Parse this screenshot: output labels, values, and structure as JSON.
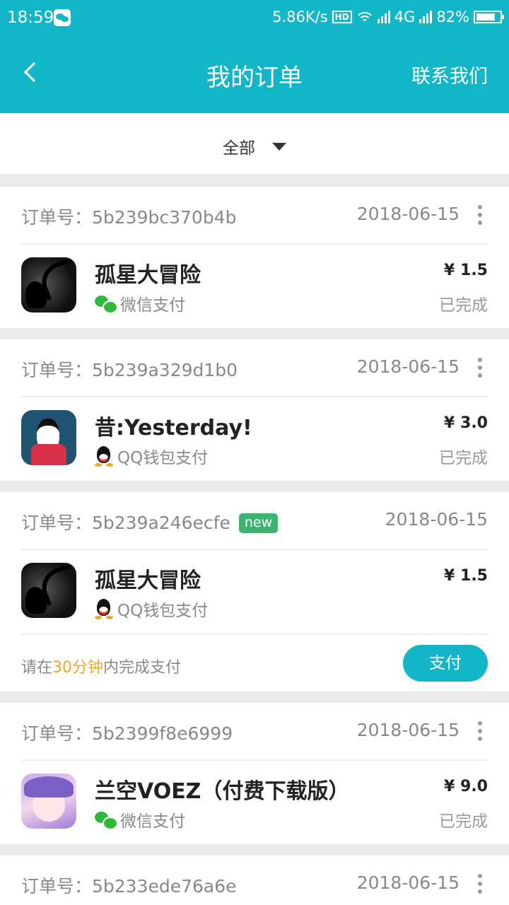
{
  "status_bar": {
    "time": "18:59",
    "speed": "5.86K/s",
    "hd": "HD",
    "network": "4G",
    "battery": "82%",
    "battery_level": 0.82
  },
  "header": {
    "title": "我的订单",
    "contact": "联系我们"
  },
  "filter": {
    "selected": "全部"
  },
  "orders": [
    {
      "order_no": "订单号：5b239bc370b4b",
      "date": "2018-06-15",
      "app_name": "孤星大冒险",
      "pay_method": "微信支付",
      "price": "¥ 1.5",
      "status": "已完成"
    },
    {
      "order_no": "订单号：5b239a329d1b0",
      "date": "2018-06-15",
      "app_name": "昔:Yesterday!",
      "pay_method": "QQ钱包支付",
      "price": "¥ 3.0",
      "status": "已完成"
    },
    {
      "order_no": "订单号：5b239a246ecfe",
      "badge": "new",
      "date": "2018-06-15",
      "app_name": "孤星大冒险",
      "pay_method": "QQ钱包支付",
      "price": "¥ 1.5",
      "hint_prefix": "请在",
      "hint_highlight": "30分钟",
      "hint_suffix": "内完成支付",
      "pay_button": "支付"
    },
    {
      "order_no": "订单号：5b2399f8e6999",
      "date": "2018-06-15",
      "app_name": "兰空VOEZ（付费下载版）",
      "pay_method": "微信支付",
      "price": "¥ 9.0",
      "status": "已完成"
    },
    {
      "order_no": "订单号：5b233ede76a6e",
      "date": "2018-06-15"
    }
  ],
  "colors": {
    "primary": "#13b6c6",
    "highlight": "#f5a623",
    "badge": "#3cb371",
    "wechat": "#2dba3a"
  }
}
